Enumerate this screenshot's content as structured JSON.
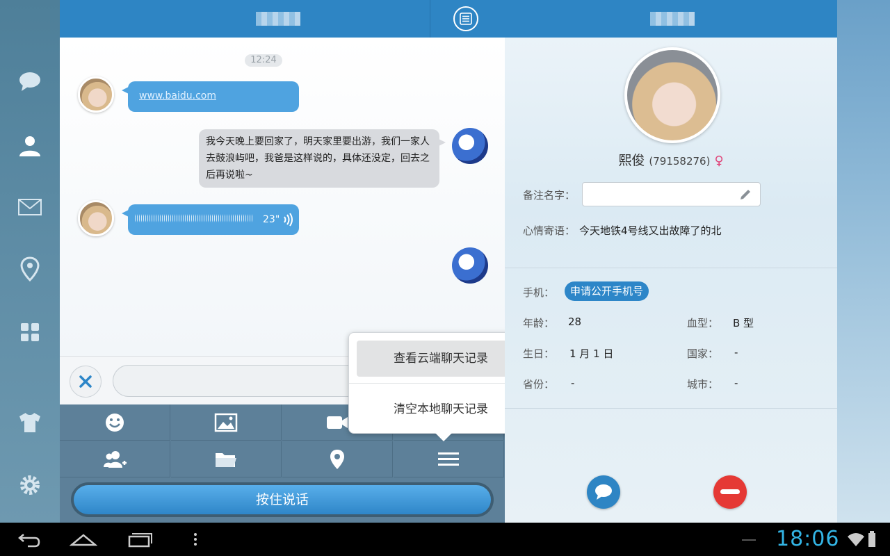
{
  "nav": {
    "items": [
      {
        "icon": "chat-bubble-icon"
      },
      {
        "icon": "contacts-icon"
      },
      {
        "icon": "mail-icon"
      },
      {
        "icon": "location-pin-icon"
      },
      {
        "icon": "apps-grid-icon"
      },
      {
        "icon": "theme-shirt-icon"
      },
      {
        "icon": "gear-icon"
      }
    ]
  },
  "chat": {
    "timestamp": "12:24",
    "messages": [
      {
        "from": "contact",
        "type": "link",
        "text": "www.baidu.com"
      },
      {
        "from": "me",
        "type": "text",
        "text": "我今天晚上要回家了，明天家里要出游，我们一家人去鼓浪屿吧，我爸是这样说的，具体还没定，回去之后再说啦~"
      },
      {
        "from": "contact",
        "type": "voice",
        "duration": "23\""
      },
      {
        "from": "me",
        "type": "avatar-only"
      }
    ],
    "input": {
      "value": "",
      "placeholder": ""
    },
    "talk_button": "按住说话"
  },
  "popup": {
    "items": [
      "查看云端聊天记录",
      "清空本地聊天记录"
    ]
  },
  "profile": {
    "name": "熙俊",
    "qq_number": "(79158276)",
    "gender_symbol": "♀",
    "remark_label": "备注名字：",
    "remark_value": "",
    "mood_label": "心情寄语：",
    "mood_text": "今天地铁4号线又出故障了的北",
    "phone_label": "手机：",
    "phone_button": "申请公开手机号",
    "age_label": "年龄：",
    "age_value": "28",
    "blood_label": "血型：",
    "blood_value": "B 型",
    "birthday_label": "生日：",
    "birthday_value": "1 月 1 日",
    "country_label": "国家：",
    "country_value": "-",
    "province_label": "省份：",
    "province_value": "-",
    "city_label": "城市：",
    "city_value": "-"
  },
  "system_bar": {
    "clock": "18:06"
  },
  "colors": {
    "header_blue": "#2e85c4",
    "bubble_blue": "#4fa3e0",
    "toolbar": "#5d8099",
    "clock_blue": "#33b5e5",
    "danger_red": "#e53935"
  }
}
